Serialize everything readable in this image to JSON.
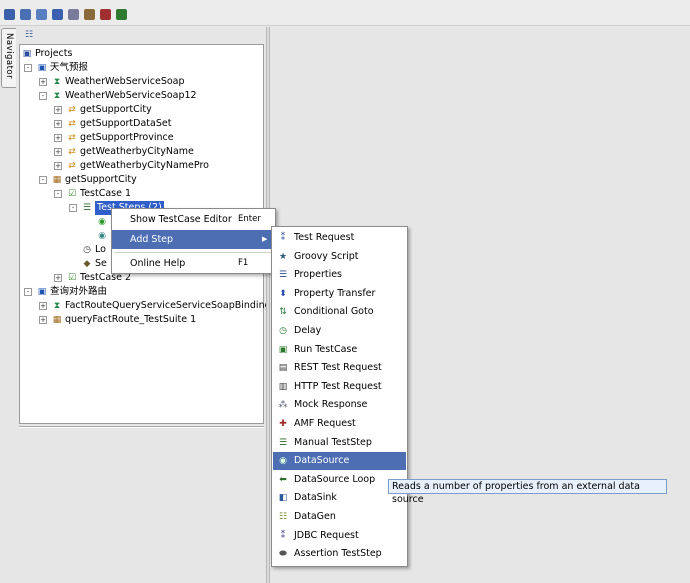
{
  "toolbar": {
    "buttons": [
      {
        "icon": "new-project-icon",
        "color": "#3b5fa8"
      },
      {
        "icon": "import-project-icon",
        "color": "#4a6fb3"
      },
      {
        "icon": "save-all-icon",
        "color": "#5a7fc0"
      },
      {
        "icon": "help-icon",
        "color": "#3a60b0"
      },
      {
        "icon": "preferences-icon",
        "color": "#7a7a9a"
      },
      {
        "icon": "tools-icon",
        "color": "#8a6a3a"
      },
      {
        "icon": "proxy-icon",
        "color": "#a03030"
      },
      {
        "icon": "loadui-icon",
        "color": "#2f7a2f"
      }
    ]
  },
  "navigator": {
    "tab_label": "Navigator",
    "tree": [
      {
        "label": "Projects",
        "depth": 0,
        "icon": "projects-icon",
        "expander": ""
      },
      {
        "label": "天气预报",
        "depth": 1,
        "icon": "project-icon",
        "expander": "-"
      },
      {
        "label": "WeatherWebServiceSoap",
        "depth": 2,
        "icon": "interface-icon",
        "expander": "+"
      },
      {
        "label": "WeatherWebServiceSoap12",
        "depth": 2,
        "icon": "interface-icon",
        "expander": "-"
      },
      {
        "label": "getSupportCity",
        "depth": 3,
        "icon": "operation-icon",
        "expander": "+"
      },
      {
        "label": "getSupportDataSet",
        "depth": 3,
        "icon": "operation-icon",
        "expander": "+"
      },
      {
        "label": "getSupportProvince",
        "depth": 3,
        "icon": "operation-icon",
        "expander": "+"
      },
      {
        "label": "getWeatherbyCityName",
        "depth": 3,
        "icon": "operation-icon",
        "expander": "+"
      },
      {
        "label": "getWeatherbyCityNamePro",
        "depth": 3,
        "icon": "operation-icon",
        "expander": "+"
      },
      {
        "label": "getSupportCity",
        "depth": 2,
        "icon": "testsuite-icon",
        "expander": "-"
      },
      {
        "label": "TestCase 1",
        "depth": 3,
        "icon": "testcase-icon",
        "expander": "-"
      },
      {
        "label": "Test Steps (2)",
        "depth": 4,
        "icon": "teststeps-icon",
        "expander": "-",
        "selected": true
      },
      {
        "label": "",
        "depth": 5,
        "icon": "soap-request-icon",
        "expander": ""
      },
      {
        "label": "",
        "depth": 5,
        "icon": "datasource-step-icon",
        "expander": ""
      },
      {
        "label": "Lo",
        "depth": 4,
        "icon": "loadtest-icon",
        "expander": ""
      },
      {
        "label": "Se",
        "depth": 4,
        "icon": "security-test-icon",
        "expander": ""
      },
      {
        "label": "TestCase 2",
        "depth": 3,
        "icon": "testcase-icon",
        "expander": "+"
      },
      {
        "label": "查询对外路由",
        "depth": 1,
        "icon": "project-icon",
        "expander": "-"
      },
      {
        "label": "FactRouteQueryServiceServiceSoapBinding",
        "depth": 2,
        "icon": "interface-icon",
        "expander": "+"
      },
      {
        "label": "queryFactRoute_TestSuite 1",
        "depth": 2,
        "icon": "testsuite-icon",
        "expander": "+"
      }
    ]
  },
  "context_menu": {
    "items": [
      {
        "label": "Show TestCase Editor",
        "shortcut": "Enter"
      },
      {
        "label": "Add Step",
        "shortcut": "",
        "submenu": true,
        "highlighted": true
      },
      {
        "label": "Online Help",
        "shortcut": "F1"
      }
    ]
  },
  "add_step_submenu": {
    "items": [
      {
        "label": "Test Request",
        "icon": "test-request-icon"
      },
      {
        "label": "Groovy Script",
        "icon": "groovy-script-icon"
      },
      {
        "label": "Properties",
        "icon": "properties-icon"
      },
      {
        "label": "Property Transfer",
        "icon": "property-transfer-icon"
      },
      {
        "label": "Conditional Goto",
        "icon": "conditional-goto-icon"
      },
      {
        "label": "Delay",
        "icon": "delay-icon"
      },
      {
        "label": "Run TestCase",
        "icon": "run-testcase-icon"
      },
      {
        "label": "REST Test Request",
        "icon": "rest-request-icon"
      },
      {
        "label": "HTTP Test Request",
        "icon": "http-request-icon"
      },
      {
        "label": "Mock Response",
        "icon": "mock-response-icon"
      },
      {
        "label": "AMF Request",
        "icon": "amf-request-icon"
      },
      {
        "label": "Manual TestStep",
        "icon": "manual-teststep-icon"
      },
      {
        "label": "DataSource",
        "icon": "datasource-icon",
        "highlighted": true
      },
      {
        "label": "DataSource Loop",
        "icon": "datasource-loop-icon"
      },
      {
        "label": "DataSink",
        "icon": "datasink-icon"
      },
      {
        "label": "DataGen",
        "icon": "datagen-icon"
      },
      {
        "label": "JDBC Request",
        "icon": "jdbc-request-icon"
      },
      {
        "label": "Assertion TestStep",
        "icon": "assertion-teststep-icon"
      }
    ]
  },
  "tooltip": {
    "text": "Reads a number of properties from an external data source"
  }
}
